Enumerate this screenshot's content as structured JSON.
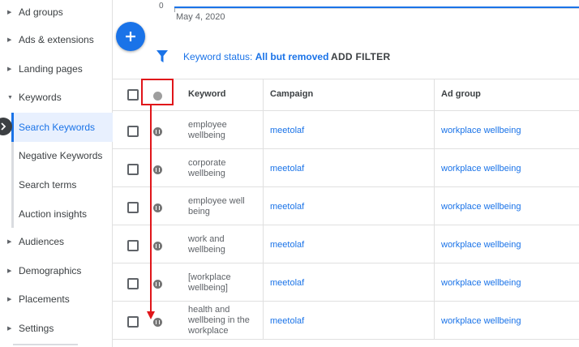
{
  "sidebar": {
    "items": [
      {
        "label": "Ad groups"
      },
      {
        "label": "Ads & extensions"
      },
      {
        "label": "Landing pages"
      },
      {
        "label": "Keywords"
      },
      {
        "label": "Audiences"
      },
      {
        "label": "Demographics"
      },
      {
        "label": "Placements"
      },
      {
        "label": "Settings"
      }
    ],
    "keyword_subitems": [
      {
        "label": "Search Keywords",
        "active": true
      },
      {
        "label": "Negative Keywords"
      },
      {
        "label": "Search terms"
      },
      {
        "label": "Auction insights"
      }
    ]
  },
  "chart": {
    "y_tick": "0",
    "x_date": "May 4, 2020"
  },
  "filter_bar": {
    "chip_label": "Keyword status: ",
    "chip_value": "All but removed",
    "add_filter_label": "ADD FILTER"
  },
  "table": {
    "headers": {
      "keyword": "Keyword",
      "campaign": "Campaign",
      "ad_group": "Ad group"
    },
    "rows": [
      {
        "keyword": "employee wellbeing",
        "campaign": "meetolaf",
        "ad_group": "workplace wellbeing",
        "status": "paused"
      },
      {
        "keyword": "corporate wellbeing",
        "campaign": "meetolaf",
        "ad_group": "workplace wellbeing",
        "status": "paused"
      },
      {
        "keyword": "employee well being",
        "campaign": "meetolaf",
        "ad_group": "workplace wellbeing",
        "status": "paused"
      },
      {
        "keyword": "work and wellbeing",
        "campaign": "meetolaf",
        "ad_group": "workplace wellbeing",
        "status": "paused"
      },
      {
        "keyword": "[workplace wellbeing]",
        "campaign": "meetolaf",
        "ad_group": "workplace wellbeing",
        "status": "paused"
      },
      {
        "keyword": "health and wellbeing in the workplace",
        "campaign": "meetolaf",
        "ad_group": "workplace wellbeing",
        "status": "paused"
      }
    ]
  },
  "colors": {
    "accent": "#1a73e8",
    "annotation": "#e0151a",
    "status_icon": "#757575"
  }
}
